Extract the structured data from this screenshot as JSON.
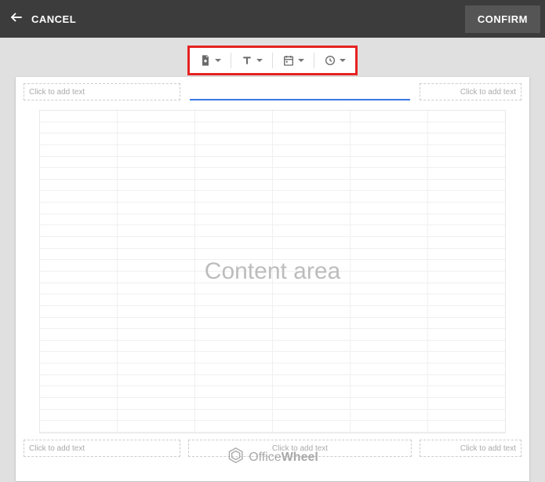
{
  "header": {
    "cancel_label": "CANCEL",
    "confirm_label": "CONFIRM"
  },
  "toolbar": {
    "items": [
      {
        "name": "add-field",
        "icon": "file-plus"
      },
      {
        "name": "text-format",
        "icon": "text"
      },
      {
        "name": "date-picker",
        "icon": "calendar"
      },
      {
        "name": "time-picker",
        "icon": "clock"
      }
    ]
  },
  "placeholders": {
    "click_to_add": "Click to add text"
  },
  "content": {
    "label": "Content area"
  },
  "watermark": {
    "brand_thin": "Office",
    "brand_bold": "Wheel"
  }
}
